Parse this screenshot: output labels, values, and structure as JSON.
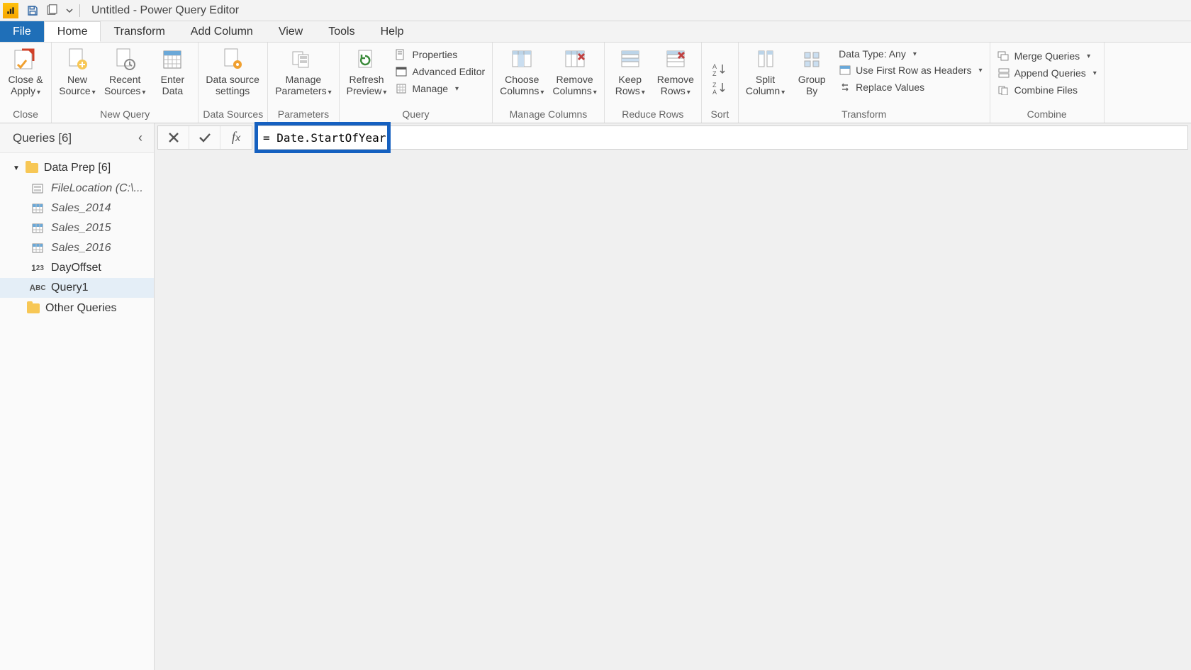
{
  "title": "Untitled - Power Query Editor",
  "tabs": {
    "file": "File",
    "home": "Home",
    "transform": "Transform",
    "addcol": "Add Column",
    "view": "View",
    "tools": "Tools",
    "help": "Help"
  },
  "ribbon": {
    "close": {
      "closeApply": "Close &\nApply",
      "group": "Close"
    },
    "newquery": {
      "newSource": "New\nSource",
      "recent": "Recent\nSources",
      "enter": "Enter\nData",
      "group": "New Query"
    },
    "datasources": {
      "btn": "Data source\nsettings",
      "group": "Data Sources"
    },
    "params": {
      "btn": "Manage\nParameters",
      "group": "Parameters"
    },
    "query": {
      "refresh": "Refresh\nPreview",
      "props": "Properties",
      "adv": "Advanced Editor",
      "manage": "Manage",
      "group": "Query"
    },
    "managecols": {
      "choose": "Choose\nColumns",
      "remove": "Remove\nColumns",
      "group": "Manage Columns"
    },
    "reducerows": {
      "keep": "Keep\nRows",
      "remove": "Remove\nRows",
      "group": "Reduce Rows"
    },
    "sort": {
      "group": "Sort"
    },
    "transform": {
      "split": "Split\nColumn",
      "group_by": "Group\nBy",
      "datatype": "Data Type: Any",
      "firstrow": "Use First Row as Headers",
      "replace": "Replace Values",
      "group": "Transform"
    },
    "combine": {
      "merge": "Merge Queries",
      "append": "Append Queries",
      "combinef": "Combine Files",
      "group": "Combine"
    }
  },
  "sidebar": {
    "header": "Queries [6]",
    "group1": "Data Prep [6]",
    "items": [
      {
        "label": "FileLocation (C:\\...",
        "type": "param"
      },
      {
        "label": "Sales_2014",
        "type": "table"
      },
      {
        "label": "Sales_2015",
        "type": "table"
      },
      {
        "label": "Sales_2016",
        "type": "table"
      },
      {
        "label": "DayOffset",
        "type": "num"
      },
      {
        "label": "Query1",
        "type": "text"
      }
    ],
    "group2": "Other Queries"
  },
  "formula": {
    "value": "= Date.StartOfYear"
  }
}
